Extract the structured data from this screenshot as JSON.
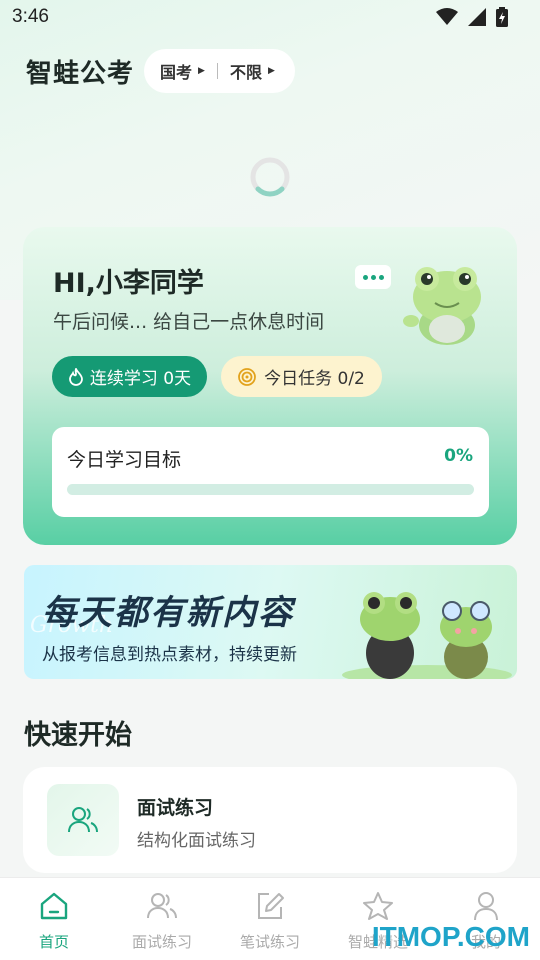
{
  "status_bar": {
    "time": "3:46"
  },
  "header": {
    "app_title": "智蛙公考",
    "exam_type": "国考",
    "region": "不限"
  },
  "greeting_card": {
    "title": "HI,小李同学",
    "subtitle": "午后问候... 给自己一点休息时间",
    "streak_label": "连续学习 0天",
    "task_label": "今日任务 0/2",
    "goal_label": "今日学习目标",
    "goal_percent": "0%",
    "goal_progress": 0
  },
  "banner": {
    "title": "每天都有新内容",
    "subtitle": "从报考信息到热点素材，持续更新"
  },
  "quick_start": {
    "section_title": "快速开始",
    "items": [
      {
        "title": "面试练习",
        "subtitle": "结构化面试练习",
        "icon": "users-icon"
      }
    ]
  },
  "bottom_nav": {
    "items": [
      {
        "label": "首页",
        "icon": "home-icon",
        "active": true
      },
      {
        "label": "面试练习",
        "icon": "users-icon",
        "active": false
      },
      {
        "label": "笔试练习",
        "icon": "edit-icon",
        "active": false
      },
      {
        "label": "智蛙精选",
        "icon": "star-icon",
        "active": false
      },
      {
        "label": "我的",
        "icon": "profile-icon",
        "active": false
      }
    ]
  },
  "watermark": "ITMOP.COM",
  "colors": {
    "accent": "#1aa57e",
    "streak_bg": "#159a74",
    "task_bg": "#fdf3cf"
  }
}
